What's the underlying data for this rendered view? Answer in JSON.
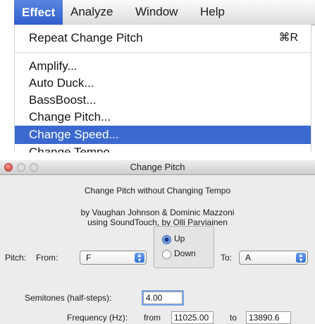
{
  "menubar": {
    "items": [
      "Effect",
      "Analyze",
      "Window",
      "Help"
    ],
    "active_index": 0
  },
  "effect_menu": {
    "repeat_item": "Repeat Change Pitch",
    "repeat_shortcut": "⌘R",
    "items": [
      "Amplify...",
      "Auto Duck...",
      "BassBoost...",
      "Change Pitch...",
      "Change Speed...",
      "Change Tempo"
    ],
    "selected_index": 4
  },
  "dialog": {
    "title": "Change Pitch",
    "heading": "Change Pitch without Changing Tempo",
    "credits_line1": "by Vaughan Johnson & Dominic Mazzoni",
    "credits_line2": "using SoundTouch, by Olli Parviainen",
    "pitch_label": "Pitch:",
    "from_label": "From:",
    "from_value": "F",
    "direction_options": [
      "Up",
      "Down"
    ],
    "direction_selected": "Up",
    "to_label": "To:",
    "to_value": "A",
    "semitones_label": "Semitones (half-steps):",
    "semitones_value": "4.00",
    "frequency_label": "Frequency (Hz):",
    "frequency_from_label": "from",
    "frequency_from_value": "11025.00",
    "frequency_to_label": "to",
    "frequency_to_value": "13890.6"
  },
  "colors": {
    "menu_selection": "#3b69cf",
    "radio_accent": "#4f84dc"
  }
}
